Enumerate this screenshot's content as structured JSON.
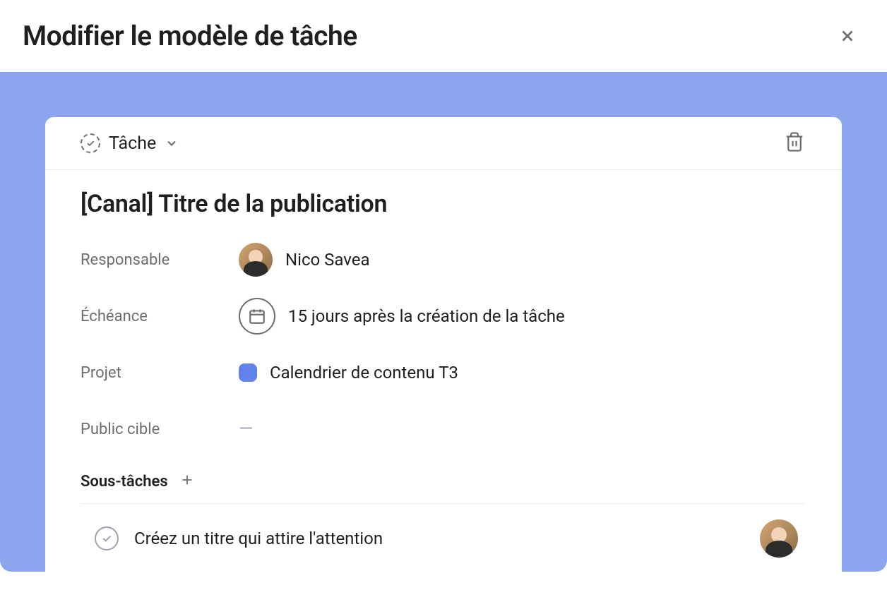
{
  "modal": {
    "title": "Modifier le modèle de tâche"
  },
  "task": {
    "type_label": "Tâche",
    "title": "[Canal] Titre de la publication",
    "fields": {
      "assignee": {
        "label": "Responsable",
        "value": "Nico Savea"
      },
      "due_date": {
        "label": "Échéance",
        "value": "15 jours après la création de la tâche"
      },
      "project": {
        "label": "Projet",
        "value": "Calendrier de contenu T3",
        "color": "#6383ea"
      },
      "audience": {
        "label": "Public cible",
        "value": "—"
      }
    },
    "subtasks": {
      "label": "Sous-tâches",
      "items": [
        {
          "title": "Créez un titre qui attire l'attention"
        }
      ]
    }
  }
}
